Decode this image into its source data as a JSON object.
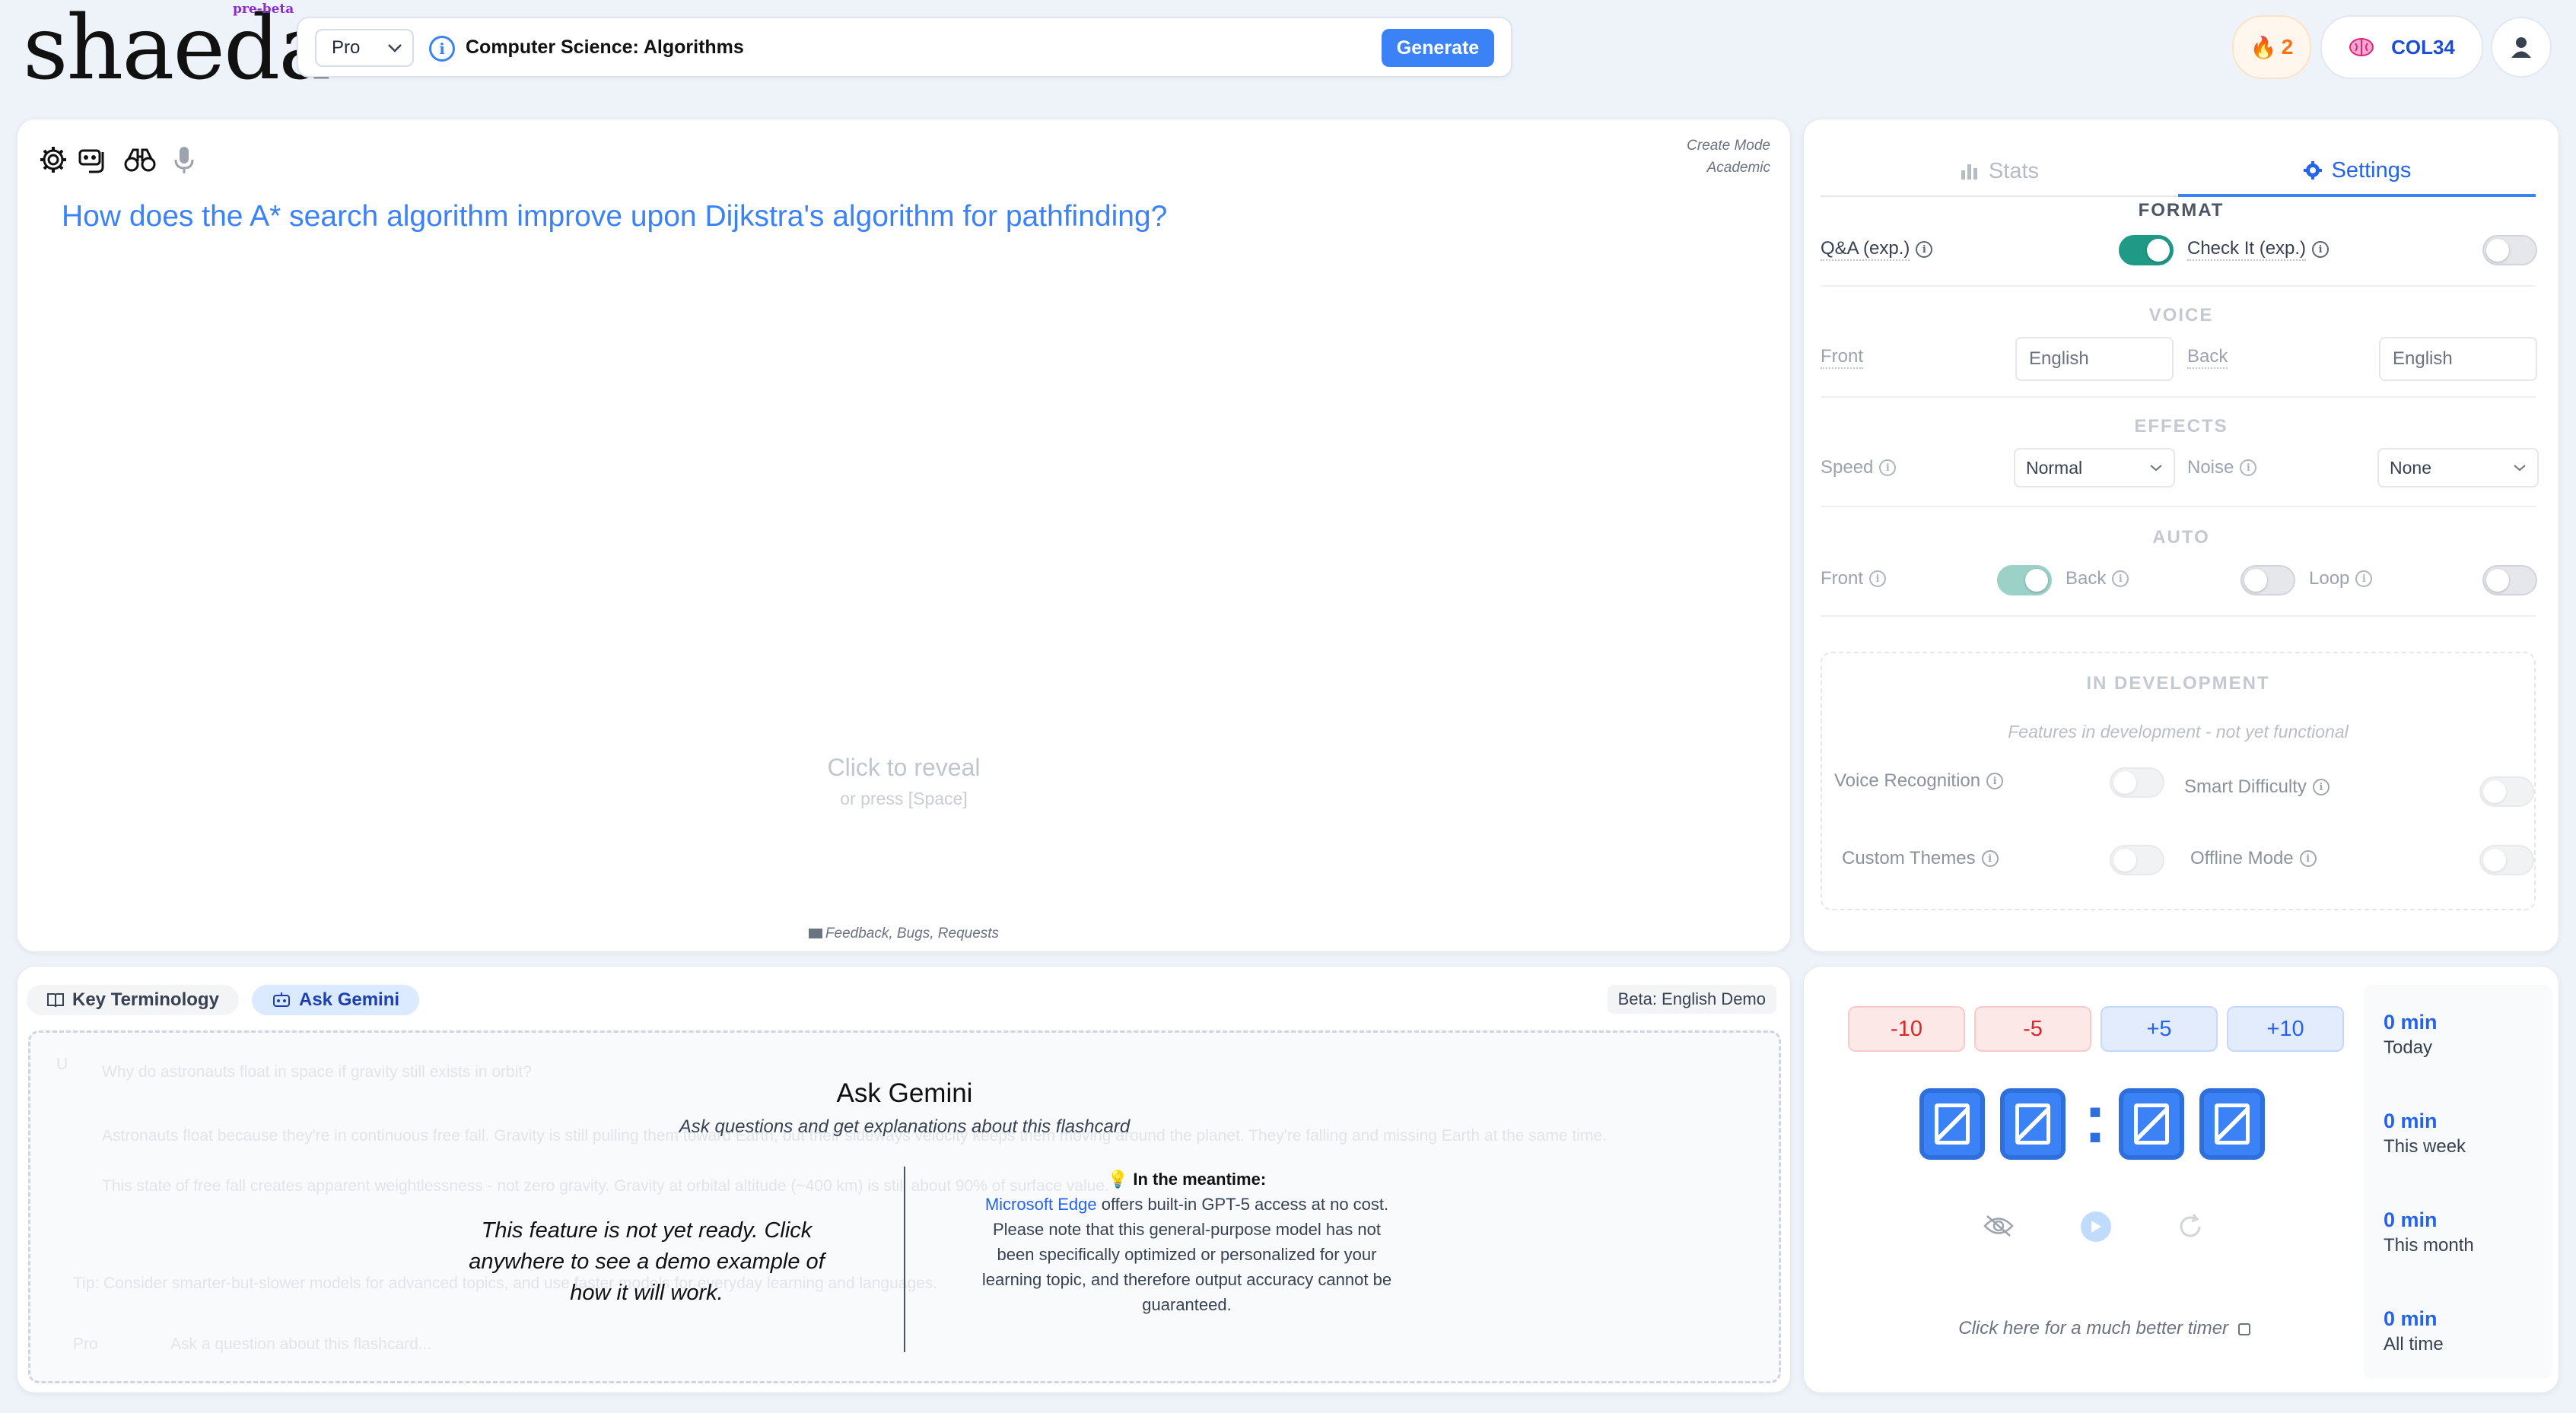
{
  "header": {
    "logo": "shaeda",
    "badge": "pre-beta",
    "tier": "Pro",
    "topic": "Computer Science: Algorithms",
    "generate_label": "Generate",
    "streak": "2",
    "course_code": "COL34"
  },
  "card": {
    "mode_line1": "Create Mode",
    "mode_line2": "Academic",
    "question": "How does the A* search algorithm improve upon Dijkstra's algorithm for pathfinding?",
    "reveal": "Click to reveal",
    "reveal_hint": "or press [Space]",
    "feedback": "Feedback, Bugs, Requests"
  },
  "settings": {
    "tab_stats": "Stats",
    "tab_settings": "Settings",
    "format_header": "FORMAT",
    "qa_label": "Q&A (exp.)",
    "qa_on": true,
    "checkit_label": "Check It (exp.)",
    "checkit_on": false,
    "voice_header": "VOICE",
    "front_label": "Front",
    "front_voice": "English",
    "back_label": "Back",
    "back_voice": "English",
    "effects_header": "EFFECTS",
    "speed_label": "Speed",
    "speed_value": "Normal",
    "noise_label": "Noise",
    "noise_value": "None",
    "auto_header": "AUTO",
    "auto_front": "Front",
    "auto_back": "Back",
    "auto_loop": "Loop",
    "dev_header": "IN DEVELOPMENT",
    "dev_note": "Features in development - not yet functional",
    "dev_voice": "Voice Recognition",
    "dev_smart": "Smart Difficulty",
    "dev_themes": "Custom Themes",
    "dev_offline": "Offline Mode"
  },
  "bottom": {
    "tab_terms": "Key Terminology",
    "tab_gemini": "Ask Gemini",
    "beta": "Beta: English Demo",
    "ghost_q": "Why do astronauts float in space if gravity still exists in orbit?",
    "ghost_a1": "Astronauts float because they're in continuous free fall. Gravity is still pulling them toward Earth, but their sideways velocity keeps them moving around the planet. They're falling and missing Earth at the same time.",
    "ghost_a2": "This state of free fall creates apparent weightlessness - not zero gravity. Gravity at orbital altitude (~400 km) is still about 90% of surface value.",
    "ghost_tip": "Tip: Consider smarter-but-slower models for advanced topics, and use faster models for everyday learning and languages.",
    "ghost_tier": "Pro",
    "ghost_input": "Ask a question about this flashcard...",
    "title": "Ask Gemini",
    "subtitle": "Ask questions and get explanations about this flashcard",
    "not_ready": "This feature is not yet ready. Click anywhere to see a demo example of how it will work.",
    "meantime_title": "In the meantime:",
    "meantime_link": "Microsoft Edge",
    "meantime_body": "offers built-in GPT-5 access at no cost. Please note that this general-purpose model has not been specifically optimized or personalized for your learning topic, and therefore output accuracy cannot be guaranteed."
  },
  "timer": {
    "minus10": "-10",
    "minus5": "-5",
    "plus5": "+5",
    "plus10": "+10",
    "better_timer": "Click here for a much better timer",
    "stats": [
      {
        "value": "0 min",
        "label": "Today"
      },
      {
        "value": "0 min",
        "label": "This week"
      },
      {
        "value": "0 min",
        "label": "This month"
      },
      {
        "value": "0 min",
        "label": "All time"
      }
    ]
  },
  "colors": {
    "accent": "#3b82f6",
    "toggle_on": "#1f9a86",
    "streak": "#f97316",
    "negative": "#dc2626"
  }
}
